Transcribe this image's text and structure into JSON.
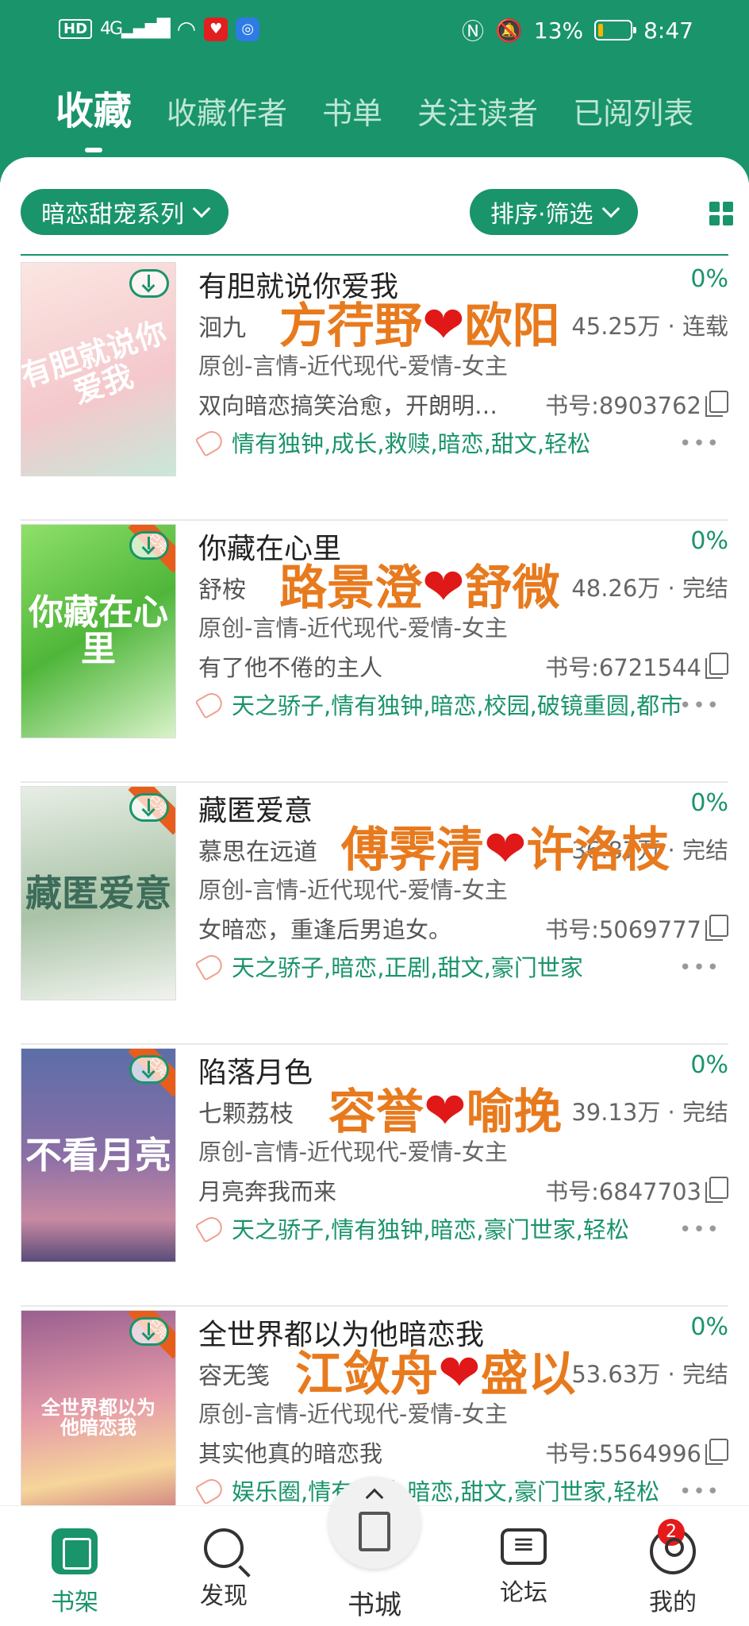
{
  "status_bar": {
    "hd": "HD",
    "network": "4G",
    "battery_pct": "13%",
    "time": "8:47"
  },
  "tabs": [
    {
      "label": "收藏",
      "active": true
    },
    {
      "label": "收藏作者",
      "active": false
    },
    {
      "label": "书单",
      "active": false
    },
    {
      "label": "关注读者",
      "active": false
    },
    {
      "label": "已阅列表",
      "active": false
    }
  ],
  "filters": {
    "category": "暗恋甜宠系列",
    "sort": "排序·筛选"
  },
  "books": [
    {
      "title": "有胆就说你爱我",
      "progress": "0%",
      "author": "洄九",
      "word_count": "45.25万 · 连载",
      "category": "原创-言情-近代现代-爱情-女主",
      "desc": "双向暗恋搞笑治愈，开朗明…",
      "book_no": "书号:8903762",
      "tags": "情有独钟,成长,救赎,暗恋,甜文,轻松",
      "overlay_left": "方荇野",
      "overlay_right": "欧阳",
      "cover_text": "有胆就说你爱我",
      "cover_color": "#f6d9d6",
      "badge": ""
    },
    {
      "title": "你藏在心里",
      "progress": "0%",
      "author": "舒桉",
      "word_count": "48.26万 · 完结",
      "category": "原创-言情-近代现代-爱情-女主",
      "desc": "有了他不倦的主人",
      "book_no": "书号:6721544",
      "tags": "天之骄子,情有独钟,暗恋,校园,破镜重圆,都市",
      "overlay_left": "路景澄",
      "overlay_right": "舒微",
      "cover_text": "你藏在心里",
      "cover_color": "#6fcf4f",
      "badge": "已完"
    },
    {
      "title": "藏匿爱意",
      "progress": "0%",
      "author": "慕思在远道",
      "word_count": "36.87万 · 完结",
      "category": "原创-言情-近代现代-爱情-女主",
      "desc": "女暗恋，重逢后男追女。",
      "book_no": "书号:5069777",
      "tags": "天之骄子,暗恋,正剧,甜文,豪门世家",
      "overlay_left": "傅霁清",
      "overlay_right": "许洛枝",
      "cover_text": "藏匿爱意",
      "cover_color": "#b9cdb8",
      "badge": "已完"
    },
    {
      "title": "陷落月色",
      "progress": "0%",
      "author": "七颗荔枝",
      "word_count": "39.13万 · 完结",
      "category": "原创-言情-近代现代-爱情-女主",
      "desc": "月亮奔我而来",
      "book_no": "书号:6847703",
      "tags": "天之骄子,情有独钟,暗恋,豪门世家,轻松",
      "overlay_left": "容誉",
      "overlay_right": "喻挽",
      "cover_text": "不看月亮",
      "cover_color": "#6a5a8c",
      "badge": "已完"
    },
    {
      "title": "全世界都以为他暗恋我",
      "progress": "0%",
      "author": "容无笺",
      "word_count": "53.63万 · 完结",
      "category": "原创-言情-近代现代-爱情-女主",
      "desc": "其实他真的暗恋我",
      "book_no": "书号:5564996",
      "tags": "娱乐圈,情有独钟,暗恋,甜文,豪门世家,轻松",
      "overlay_left": "江敛舟",
      "overlay_right": "盛以",
      "cover_text": "全世界都以为他暗恋我",
      "cover_color": "#d98aa0",
      "badge": "已完"
    }
  ],
  "heart": "❤",
  "more": "•••",
  "nav": {
    "shelf": "书架",
    "discover": "发现",
    "store": "书城",
    "forum": "论坛",
    "mine": "我的",
    "mine_badge": "2"
  },
  "colors": {
    "accent": "#1a946a",
    "overlay_text": "#e87a1e",
    "heart": "#e01818"
  }
}
